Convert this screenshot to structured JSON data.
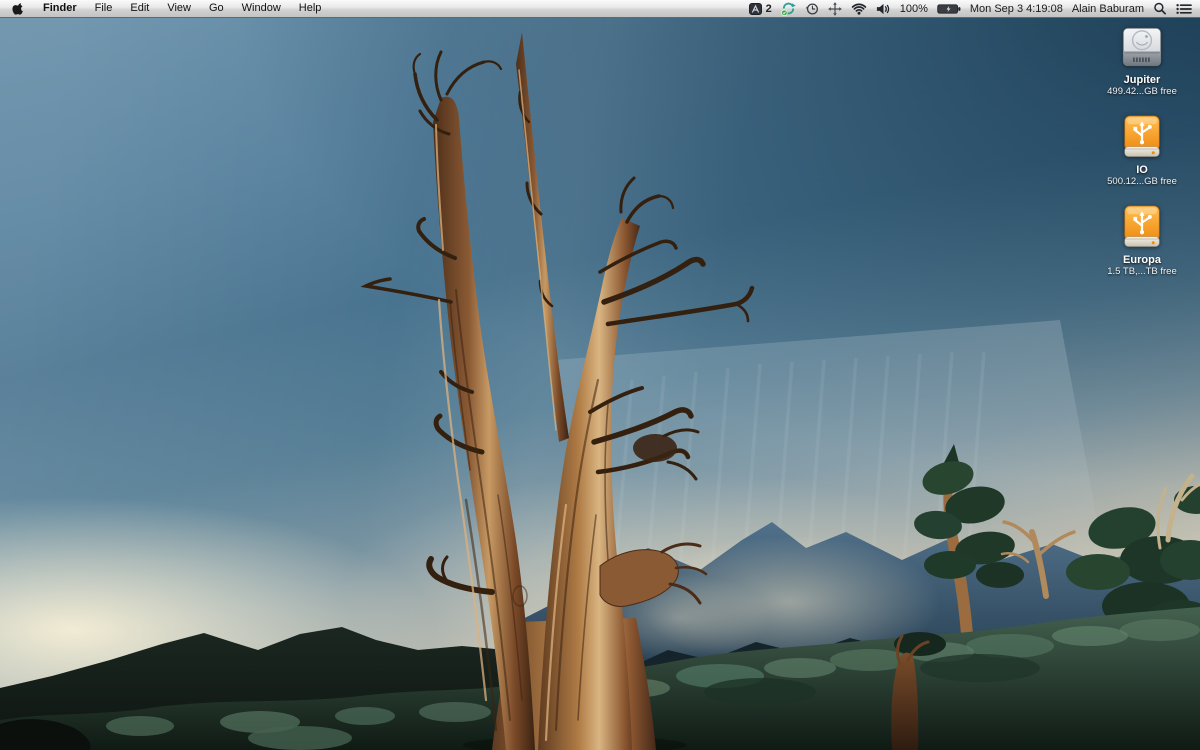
{
  "menu_bar": {
    "menus": [
      "Finder",
      "File",
      "Edit",
      "View",
      "Go",
      "Window",
      "Help"
    ],
    "status": {
      "app_badge_count": "2",
      "battery_percent": "100%",
      "clock": "Mon Sep 3  4:19:08",
      "user_name": "Alain Baburam",
      "icons": [
        "app-indicator",
        "sync",
        "time-machine",
        "move-arrows",
        "wifi",
        "volume",
        "battery",
        "spotlight",
        "list-menu"
      ]
    }
  },
  "desktop_icons": [
    {
      "label": "Jupiter",
      "info": "499.42...GB free",
      "kind": "internal-drive"
    },
    {
      "label": "IO",
      "info": "500.12...GB free",
      "kind": "usb-drive"
    },
    {
      "label": "Europa",
      "info": "1.5 TB,...TB free",
      "kind": "usb-drive"
    }
  ],
  "wallpaper": {
    "description": "Ancient bristlecone pine snag at dusk, stormy sky over mountain basin",
    "colors": {
      "sky_mid": "#48738f",
      "sky_dark": "#1e4a66",
      "horizon_glow": "#e8dfc0",
      "far_mountain": "#3c5a74",
      "dark_ridge": "#151f1a",
      "vegetation": "#3c584a",
      "tree_wood": "#a9713d",
      "drive_orange": "#ee8a10"
    }
  }
}
